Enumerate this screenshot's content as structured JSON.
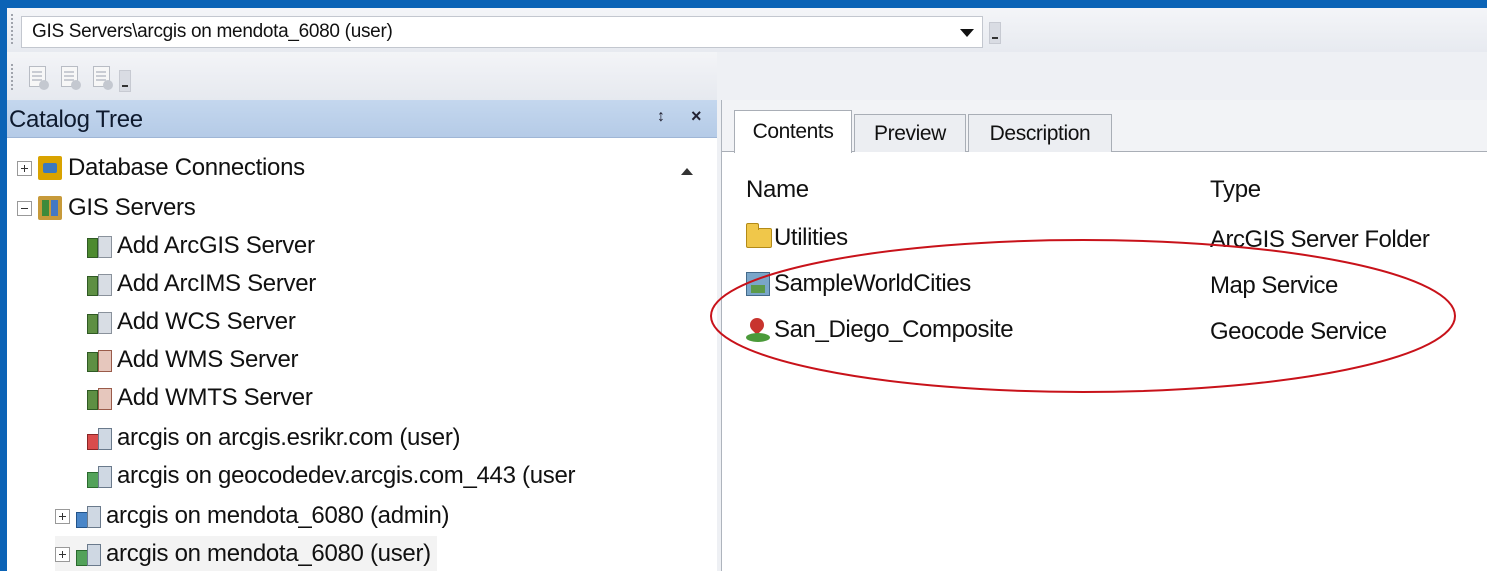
{
  "location_bar": {
    "path": "GIS Servers\\arcgis on mendota_6080 (user)"
  },
  "toolbar": {
    "icons": [
      "refresh-page-icon",
      "new-page-icon",
      "copy-page-icon"
    ]
  },
  "catalog": {
    "title": "Catalog Tree",
    "pin_glyph": "↕",
    "close_glyph": "×",
    "tree": [
      {
        "label": "Database Connections",
        "expander": "plus",
        "icon": "database-connections-icon"
      },
      {
        "label": "GIS Servers",
        "expander": "minus",
        "icon": "gis-servers-icon"
      },
      {
        "label": "Add ArcGIS Server",
        "icon": "add-server-icon"
      },
      {
        "label": "Add ArcIMS Server",
        "icon": "add-server-icon"
      },
      {
        "label": "Add WCS Server",
        "icon": "add-server-icon"
      },
      {
        "label": "Add WMS Server",
        "icon": "add-server-icon"
      },
      {
        "label": "Add WMTS Server",
        "icon": "add-server-icon"
      },
      {
        "label": "arcgis on arcgis.esrikr.com (user)",
        "icon": "server-connection-icon"
      },
      {
        "label": "arcgis on geocodedev.arcgis.com_443 (user",
        "icon": "server-connection-icon"
      },
      {
        "label": "arcgis on mendota_6080 (admin)",
        "expander": "plus",
        "icon": "server-connection-icon"
      },
      {
        "label": "arcgis on mendota_6080 (user)",
        "expander": "plus",
        "icon": "server-connection-icon",
        "selected": true
      }
    ]
  },
  "tabs": [
    {
      "label": "Contents",
      "active": true
    },
    {
      "label": "Preview",
      "active": false
    },
    {
      "label": "Description",
      "active": false
    }
  ],
  "contents": {
    "columns": {
      "name": "Name",
      "type": "Type"
    },
    "rows": [
      {
        "name": "Utilities",
        "type": "ArcGIS Server Folder",
        "icon": "folder-icon"
      },
      {
        "name": "SampleWorldCities",
        "type": "Map Service",
        "icon": "map-service-icon"
      },
      {
        "name": "San_Diego_Composite",
        "type": "Geocode Service",
        "icon": "geocode-service-icon"
      }
    ]
  },
  "colors": {
    "background": "#0b63b6",
    "panel_header": "#c4d7ee",
    "annotation_ellipse": "#c8121a"
  }
}
